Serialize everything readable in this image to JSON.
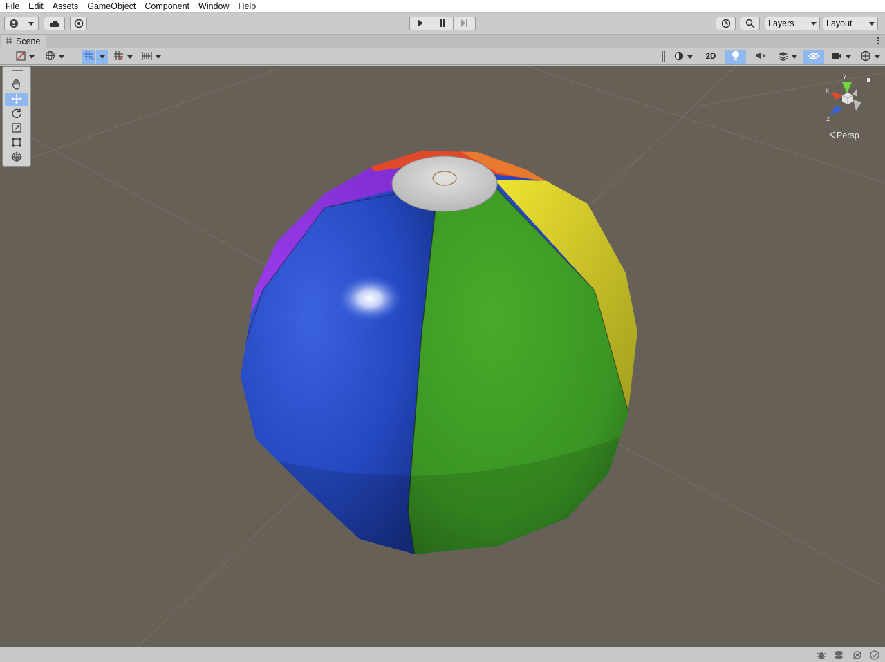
{
  "menu": [
    "File",
    "Edit",
    "Assets",
    "GameObject",
    "Component",
    "Window",
    "Help"
  ],
  "toolbar": {
    "account_icon": "account-icon",
    "cloud_icon": "cloud-icon",
    "services_icon": "services-gear-icon",
    "play_icon": "play-icon",
    "pause_icon": "pause-icon",
    "step_icon": "step-icon",
    "history_icon": "history-icon",
    "search_icon": "search-icon",
    "layers_label": "Layers",
    "layout_label": "Layout"
  },
  "scene_tab": {
    "label": "Scene"
  },
  "scene_toolbar": {
    "button_2d": "2D",
    "icons": [
      "draw-mode-icon",
      "global-icon",
      "grid-snap-icon",
      "increment-snap-icon",
      "ruler-icon",
      "shading-icon",
      "lighting-icon",
      "audio-icon",
      "effects-icon",
      "hidden-objects-icon",
      "camera-icon",
      "gizmos-icon"
    ]
  },
  "tools": [
    "hand-tool-icon",
    "move-tool-icon",
    "rotate-tool-icon",
    "scale-tool-icon",
    "rect-tool-icon",
    "transform-tool-icon"
  ],
  "gizmo": {
    "y_label": "y",
    "x_label": "x",
    "z_label": "z",
    "projection_label": "Persp"
  },
  "colors": {
    "viewport_bg": "#666057",
    "selected_blue": "#8fb8ee",
    "ball_blue": "#2448c0",
    "ball_green": "#3a9a24",
    "ball_yellow": "#d6cc28",
    "ball_purple": "#8a2ee0",
    "ball_red": "#e03a28",
    "ball_cap": "#cfcfcf"
  },
  "statusbar": {
    "icons": [
      "bug-icon",
      "cache-icon",
      "auto-generate-lighting-icon",
      "check-icon"
    ]
  }
}
